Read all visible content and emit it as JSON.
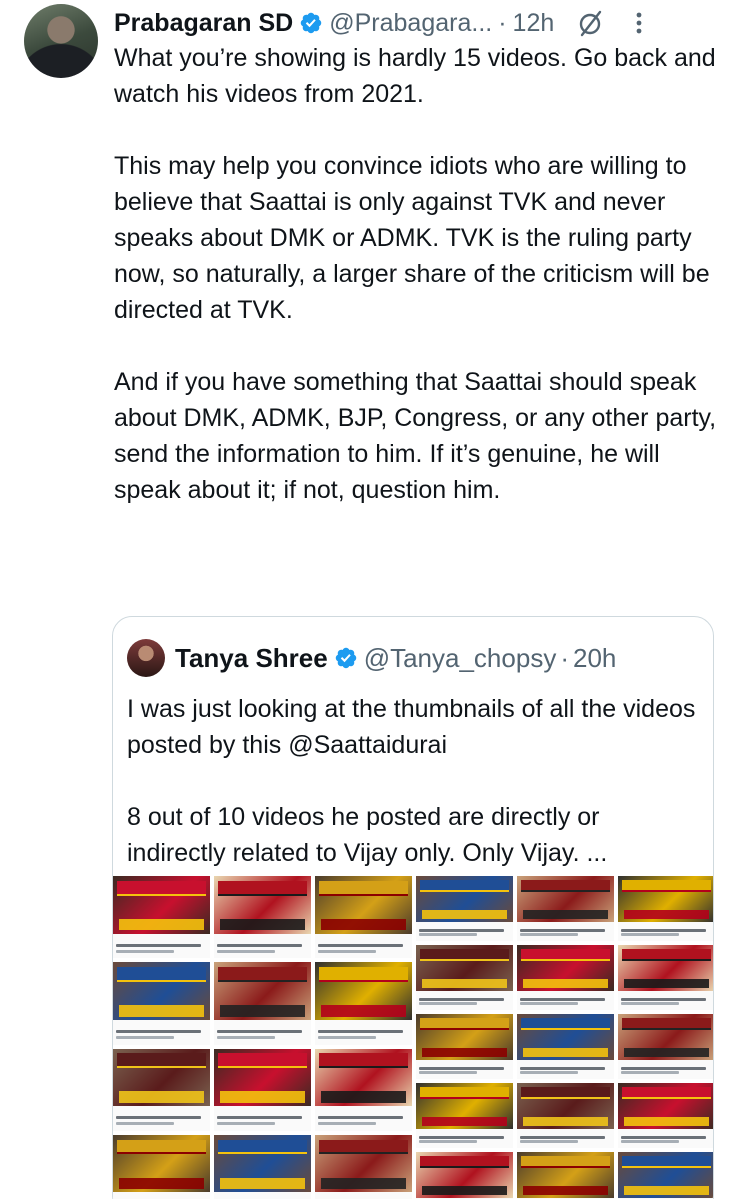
{
  "tweet": {
    "author_name": "Prabagaran SD",
    "author_handle": "@Prabagara...",
    "separator": "·",
    "timestamp": "12h",
    "paragraphs": [
      "What you’re showing is hardly 15 videos. Go back and watch his videos from 2021.",
      "This may help you convince idiots who are willing to believe that Saattai is only against TVK and never speaks about DMK or ADMK. TVK is the ruling party now, so naturally, a larger share of the criticism will be directed at TVK.",
      "And if you have something that Saattai should speak about DMK, ADMK, BJP, Congress, or any other party, send the information to him. If it’s genuine, he will speak about it; if not, question him."
    ]
  },
  "quote": {
    "author_name": "Tanya Shree",
    "author_handle": "@Tanya_chopsy",
    "separator": "·",
    "timestamp": "20h",
    "paragraphs": [
      "I was just looking at the thumbnails of all the videos posted by this @Saattaidurai",
      "8 out of 10 videos he posted are directly or indirectly related to Vijay only. Only Vijay. ..."
    ]
  },
  "icons": {
    "verified": "verified-badge-icon",
    "grok": "grok-slash-icon",
    "more": "more-vertical-icon"
  },
  "colors": {
    "text": "#0f1419",
    "secondary": "#536471",
    "verified_blue": "#1d9bf0",
    "card_border": "#cfd9de",
    "thumb_red": "#c8102e",
    "thumb_yellow": "#f4c20d"
  }
}
